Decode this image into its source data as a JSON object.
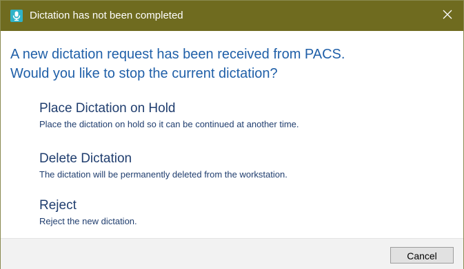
{
  "window": {
    "title": "Dictation has not been completed",
    "icon": "microphone-icon",
    "close_glyph": "✕",
    "titlebar_color": "#6f6b1f"
  },
  "question": {
    "line1": "A new dictation request has been received from PACS.",
    "line2": "Would you like to stop the current dictation?"
  },
  "options": [
    {
      "title": "Place Dictation on Hold",
      "description": "Place the dictation on hold so it can be continued at another time."
    },
    {
      "title": "Delete Dictation",
      "description": "The dictation will be permanently deleted from the workstation."
    },
    {
      "title": "Reject",
      "description": "Reject the new dictation."
    }
  ],
  "footer": {
    "cancel_label": "Cancel"
  },
  "colors": {
    "heading": "#1f5fa8",
    "option_text": "#1f3d6e"
  }
}
